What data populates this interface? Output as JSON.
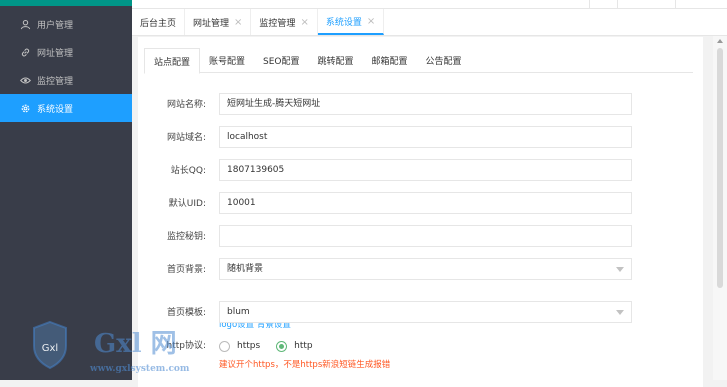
{
  "sidebar": {
    "items": [
      {
        "label": "用户管理",
        "icon": "user-icon"
      },
      {
        "label": "网址管理",
        "icon": "link-icon"
      },
      {
        "label": "监控管理",
        "icon": "eye-icon"
      },
      {
        "label": "系统设置",
        "icon": "gear-icon"
      }
    ]
  },
  "tabs": [
    {
      "label": "后台主页"
    },
    {
      "label": "网址管理",
      "close": "×"
    },
    {
      "label": "监控管理",
      "close": "×"
    },
    {
      "label": "系统设置",
      "close": "×"
    }
  ],
  "subtabs": [
    "站点配置",
    "账号配置",
    "SEO配置",
    "跳转配置",
    "邮箱配置",
    "公告配置"
  ],
  "form": {
    "site_name": {
      "label": "网站名称:",
      "value": "短网址生成-腾天短网址"
    },
    "site_domain": {
      "label": "网站域名:",
      "value": "localhost"
    },
    "owner_qq": {
      "label": "站长QQ:",
      "value": "1807139605"
    },
    "default_uid": {
      "label": "默认UID:",
      "value": "10001"
    },
    "monitor_key": {
      "label": "监控秘钥:",
      "value": ""
    },
    "home_bg": {
      "label": "首页背景:",
      "value": "随机背景"
    },
    "home_bg_links": {
      "logo": "logo设置",
      "bg": "背景设置"
    },
    "home_template": {
      "label": "首页模板:",
      "value": "blum"
    },
    "protocol": {
      "label": "http协议:",
      "options": [
        "https",
        "http"
      ],
      "selected": "http"
    },
    "warning": "建议开个https，不是https新浪短链生成报错"
  },
  "watermark": {
    "text": "Gxl 网",
    "url": "www.gxlsystem.com",
    "badge": "Gxl"
  },
  "colors": {
    "sidebar": "#393d49",
    "accent": "#1e9fff",
    "warning": "#ff5722",
    "radio": "#5fb878"
  }
}
